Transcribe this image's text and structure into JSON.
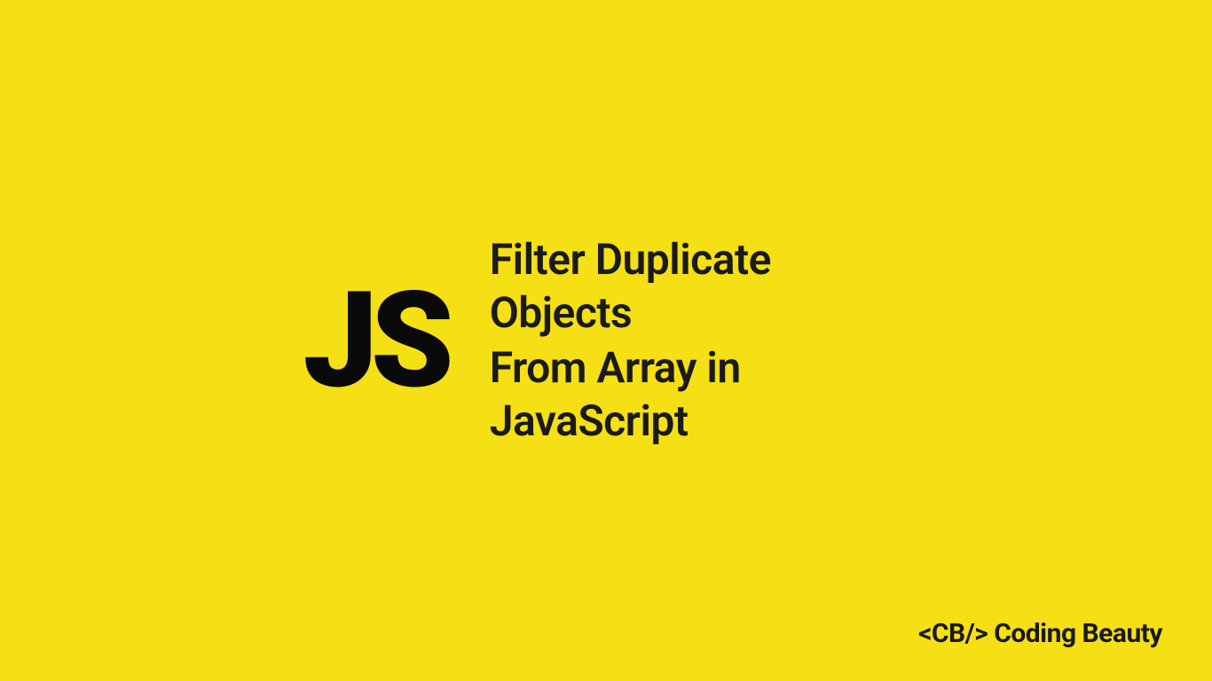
{
  "badge": {
    "label": "JS"
  },
  "title": {
    "line1": "Filter Duplicate Objects",
    "line2": "From Array in JavaScript"
  },
  "brand": {
    "text": "<CB/> Coding Beauty"
  },
  "colors": {
    "background": "#F5DF15",
    "text": "#0A0A0A"
  }
}
